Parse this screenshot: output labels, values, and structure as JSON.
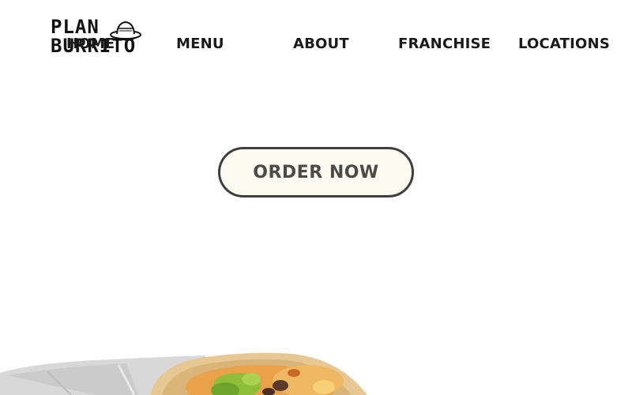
{
  "logo": {
    "line1": "PLAN",
    "line2": "BURRITO",
    "hat_icon": "sombrero-icon",
    "accent_color": "#e8b23a"
  },
  "nav": {
    "home": "HOME",
    "menu": "MENU",
    "about": "ABOUT",
    "franchise": "FRANCHISE",
    "locations": "LOCATIONS"
  },
  "hero": {
    "order_label": "ORDER NOW",
    "button_border_color": "#3f3f3f",
    "button_bg_color": "#fcfbf2"
  },
  "image": {
    "subject": "burrito-wrap-image"
  }
}
